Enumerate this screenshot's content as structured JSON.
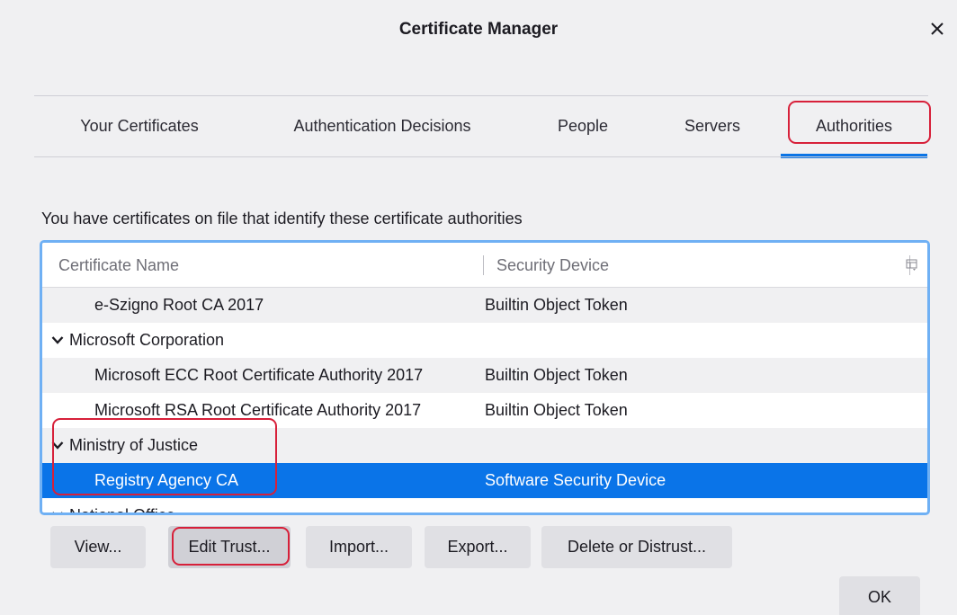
{
  "window": {
    "title": "Certificate Manager",
    "close_icon": "close-icon"
  },
  "tabs": [
    {
      "label": "Your Certificates",
      "selected": false
    },
    {
      "label": "Authentication Decisions",
      "selected": false
    },
    {
      "label": "People",
      "selected": false
    },
    {
      "label": "Servers",
      "selected": false
    },
    {
      "label": "Authorities",
      "selected": true
    }
  ],
  "description": "You have certificates on file that identify these certificate authorities",
  "table": {
    "columns": [
      "Certificate Name",
      "Security Device"
    ],
    "rows": [
      {
        "name": "e-Szigno Root CA 2017",
        "device": "Builtin Object Token",
        "type": "cert",
        "selected": false
      },
      {
        "name": "Microsoft Corporation",
        "device": "",
        "type": "group",
        "selected": false
      },
      {
        "name": "Microsoft ECC Root Certificate Authority 2017",
        "device": "Builtin Object Token",
        "type": "cert",
        "selected": false
      },
      {
        "name": "Microsoft RSA Root Certificate Authority 2017",
        "device": "Builtin Object Token",
        "type": "cert",
        "selected": false
      },
      {
        "name": "Ministry of Justice",
        "device": "",
        "type": "group",
        "selected": false
      },
      {
        "name": "Registry Agency CA",
        "device": "Software Security Device",
        "type": "cert",
        "selected": true
      },
      {
        "name": "National Office",
        "device": "",
        "type": "group",
        "selected": false
      }
    ]
  },
  "buttons": {
    "view": "View...",
    "edit_trust": "Edit Trust...",
    "import": "Import...",
    "export": "Export...",
    "delete": "Delete or Distrust...",
    "ok": "OK"
  },
  "colors": {
    "accent": "#0a74e8",
    "annotation": "#d7203a"
  }
}
